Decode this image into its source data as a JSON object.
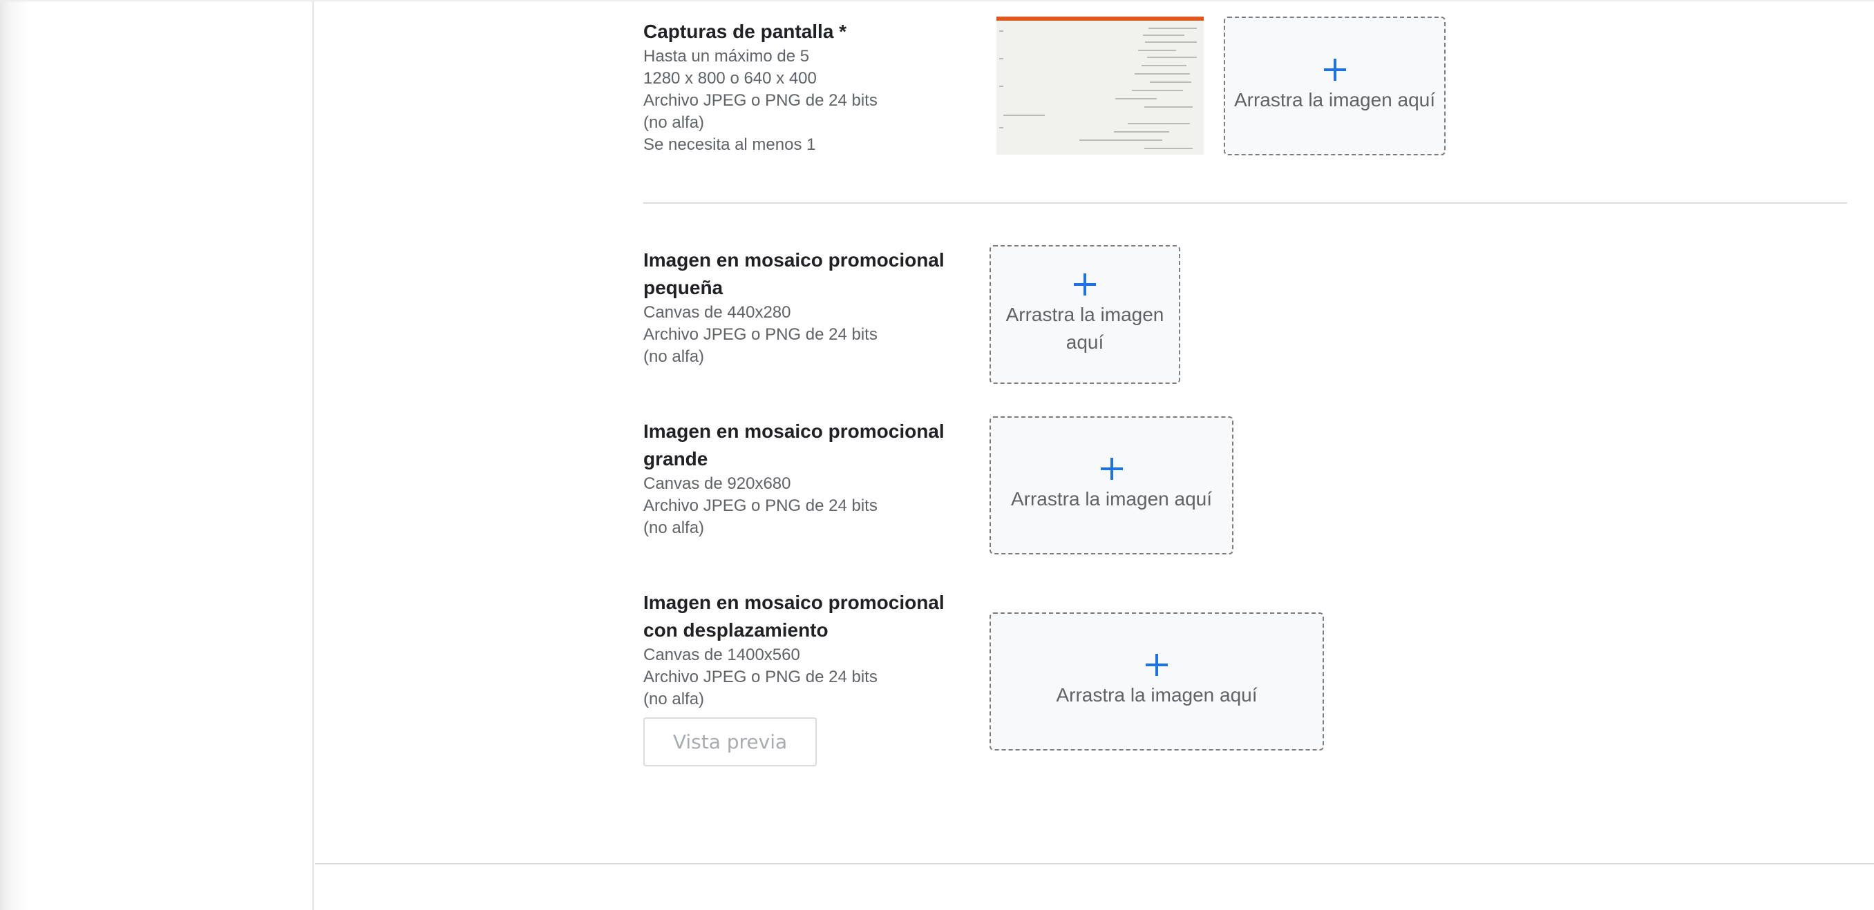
{
  "screenshots": {
    "title": "Capturas de pantalla *",
    "lines": [
      "Hasta un máximo de 5",
      "1280 x 800 o 640 x 400",
      "Archivo JPEG o PNG de 24 bits",
      "(no alfa)",
      "Se necesita al menos 1"
    ],
    "dropzone_label": "Arrastra la imagen aquí"
  },
  "small_tile": {
    "title": "Imagen en mosaico promocional pequeña",
    "lines": [
      "Canvas de 440x280",
      "Archivo JPEG o PNG de 24 bits",
      "(no alfa)"
    ],
    "dropzone_label": "Arrastra la imagen aquí"
  },
  "large_tile": {
    "title": "Imagen en mosaico promocional grande",
    "lines": [
      "Canvas de 920x680",
      "Archivo JPEG o PNG de 24 bits",
      "(no alfa)"
    ],
    "dropzone_label": "Arrastra la imagen aquí"
  },
  "marquee_tile": {
    "title": "Imagen en mosaico promocional con desplazamiento",
    "lines": [
      "Canvas de 1400x560",
      "Archivo JPEG o PNG de 24 bits",
      "(no alfa)"
    ],
    "dropzone_label": "Arrastra la imagen aquí",
    "preview_button": "Vista previa"
  },
  "icons": {
    "add": "plus-icon",
    "thumbnail": "screenshot-thumbnail"
  },
  "colors": {
    "accent": "#1a73e8",
    "thumbnail_bar": "#e0581d"
  }
}
